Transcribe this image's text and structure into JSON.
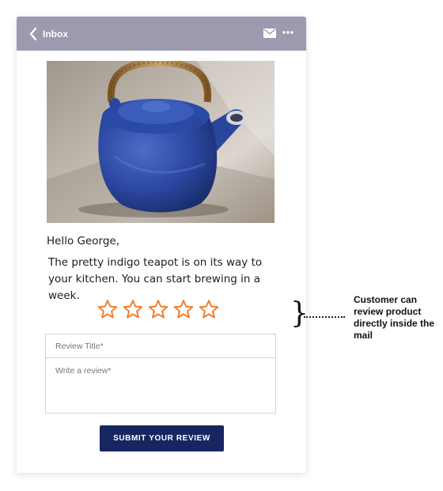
{
  "header": {
    "back_label": "Inbox",
    "back_icon": "chevron-left-icon",
    "mail_icon": "envelope-icon",
    "more_icon": "more-horizontal-icon",
    "bar_color": "#9b9aaf"
  },
  "email": {
    "greeting": "Hello George,",
    "message": "The pretty indigo teapot is on its way to your kitchen. You can start brewing in a week."
  },
  "rating": {
    "max": 5,
    "value": 0,
    "star_color": "#f07f2d"
  },
  "review_form": {
    "title_placeholder": "Review Title*",
    "body_placeholder": "Write a review*",
    "submit_label": "SUBMIT YOUR REVIEW",
    "submit_color": "#172561"
  },
  "annotation": {
    "text": "Customer can review product directly inside the mail"
  }
}
